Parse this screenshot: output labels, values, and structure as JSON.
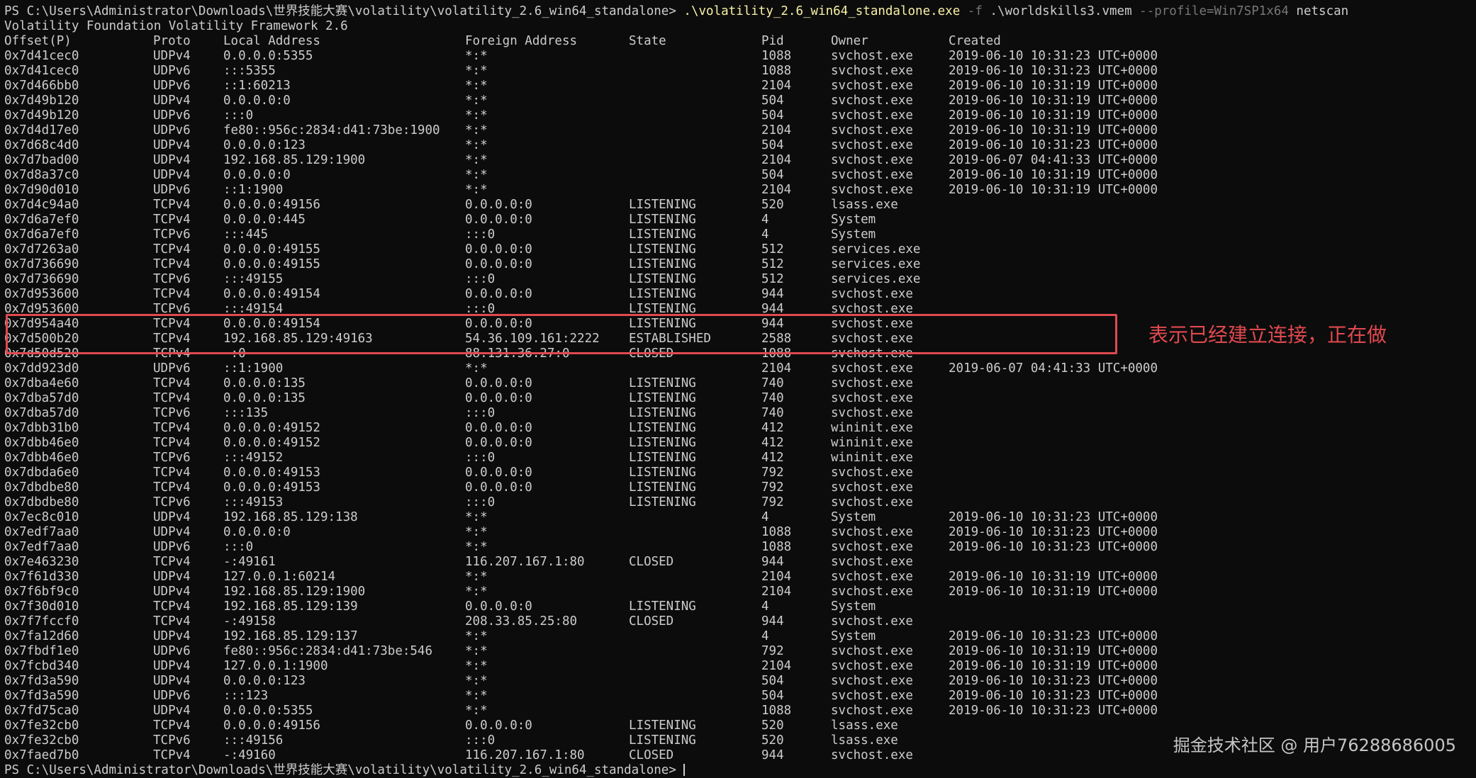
{
  "terminal": {
    "command_line": {
      "prompt": "PS C:\\Users\\Administrator\\Downloads\\世界技能大赛\\volatility\\volatility_2.6_win64_standalone> ",
      "executable": ".\\volatility_2.6_win64_standalone.exe",
      "flag_f": "-f",
      "file_arg": ".\\worldskills3.vmem",
      "flag_profile": "--profile=Win7SP1x64",
      "plugin": "netscan"
    },
    "banner": "Volatility Foundation Volatility Framework 2.6",
    "headers": {
      "offset": "Offset(P)",
      "proto": "Proto",
      "local": "Local Address",
      "foreign": "Foreign Address",
      "state": "State",
      "pid": "Pid",
      "owner": "Owner",
      "created": "Created"
    },
    "rows": [
      {
        "offset": "0x7d41cec0",
        "proto": "UDPv4",
        "local": "0.0.0.0:5355",
        "foreign": "*:*",
        "state": "",
        "pid": "1088",
        "owner": "svchost.exe",
        "created": "2019-06-10 10:31:23 UTC+0000"
      },
      {
        "offset": "0x7d41cec0",
        "proto": "UDPv6",
        "local": ":::5355",
        "foreign": "*:*",
        "state": "",
        "pid": "1088",
        "owner": "svchost.exe",
        "created": "2019-06-10 10:31:23 UTC+0000"
      },
      {
        "offset": "0x7d466bb0",
        "proto": "UDPv6",
        "local": "::1:60213",
        "foreign": "*:*",
        "state": "",
        "pid": "2104",
        "owner": "svchost.exe",
        "created": "2019-06-10 10:31:19 UTC+0000"
      },
      {
        "offset": "0x7d49b120",
        "proto": "UDPv4",
        "local": "0.0.0.0:0",
        "foreign": "*:*",
        "state": "",
        "pid": "504",
        "owner": "svchost.exe",
        "created": "2019-06-10 10:31:19 UTC+0000"
      },
      {
        "offset": "0x7d49b120",
        "proto": "UDPv6",
        "local": ":::0",
        "foreign": "*:*",
        "state": "",
        "pid": "504",
        "owner": "svchost.exe",
        "created": "2019-06-10 10:31:19 UTC+0000"
      },
      {
        "offset": "0x7d4d17e0",
        "proto": "UDPv6",
        "local": "fe80::956c:2834:d41:73be:1900",
        "foreign": "*:*",
        "state": "",
        "pid": "2104",
        "owner": "svchost.exe",
        "created": "2019-06-10 10:31:19 UTC+0000"
      },
      {
        "offset": "0x7d68c4d0",
        "proto": "UDPv4",
        "local": "0.0.0.0:123",
        "foreign": "*:*",
        "state": "",
        "pid": "504",
        "owner": "svchost.exe",
        "created": "2019-06-10 10:31:23 UTC+0000"
      },
      {
        "offset": "0x7d7bad00",
        "proto": "UDPv4",
        "local": "192.168.85.129:1900",
        "foreign": "*:*",
        "state": "",
        "pid": "2104",
        "owner": "svchost.exe",
        "created": "2019-06-07 04:41:33 UTC+0000"
      },
      {
        "offset": "0x7d8a37c0",
        "proto": "UDPv4",
        "local": "0.0.0.0:0",
        "foreign": "*:*",
        "state": "",
        "pid": "504",
        "owner": "svchost.exe",
        "created": "2019-06-10 10:31:19 UTC+0000"
      },
      {
        "offset": "0x7d90d010",
        "proto": "UDPv6",
        "local": "::1:1900",
        "foreign": "*:*",
        "state": "",
        "pid": "2104",
        "owner": "svchost.exe",
        "created": "2019-06-10 10:31:19 UTC+0000"
      },
      {
        "offset": "0x7d4c94a0",
        "proto": "TCPv4",
        "local": "0.0.0.0:49156",
        "foreign": "0.0.0.0:0",
        "state": "LISTENING",
        "pid": "520",
        "owner": "lsass.exe",
        "created": ""
      },
      {
        "offset": "0x7d6a7ef0",
        "proto": "TCPv4",
        "local": "0.0.0.0:445",
        "foreign": "0.0.0.0:0",
        "state": "LISTENING",
        "pid": "4",
        "owner": "System",
        "created": ""
      },
      {
        "offset": "0x7d6a7ef0",
        "proto": "TCPv6",
        "local": ":::445",
        "foreign": ":::0",
        "state": "LISTENING",
        "pid": "4",
        "owner": "System",
        "created": ""
      },
      {
        "offset": "0x7d7263a0",
        "proto": "TCPv4",
        "local": "0.0.0.0:49155",
        "foreign": "0.0.0.0:0",
        "state": "LISTENING",
        "pid": "512",
        "owner": "services.exe",
        "created": ""
      },
      {
        "offset": "0x7d736690",
        "proto": "TCPv4",
        "local": "0.0.0.0:49155",
        "foreign": "0.0.0.0:0",
        "state": "LISTENING",
        "pid": "512",
        "owner": "services.exe",
        "created": ""
      },
      {
        "offset": "0x7d736690",
        "proto": "TCPv6",
        "local": ":::49155",
        "foreign": ":::0",
        "state": "LISTENING",
        "pid": "512",
        "owner": "services.exe",
        "created": ""
      },
      {
        "offset": "0x7d953600",
        "proto": "TCPv4",
        "local": "0.0.0.0:49154",
        "foreign": "0.0.0.0:0",
        "state": "LISTENING",
        "pid": "944",
        "owner": "svchost.exe",
        "created": ""
      },
      {
        "offset": "0x7d953600",
        "proto": "TCPv6",
        "local": ":::49154",
        "foreign": ":::0",
        "state": "LISTENING",
        "pid": "944",
        "owner": "svchost.exe",
        "created": ""
      },
      {
        "offset": "0x7d954a40",
        "proto": "TCPv4",
        "local": "0.0.0.0:49154",
        "foreign": "0.0.0.0:0",
        "state": "LISTENING",
        "pid": "944",
        "owner": "svchost.exe",
        "created": ""
      },
      {
        "offset": "0x7d500b20",
        "proto": "TCPv4",
        "local": "192.168.85.129:49163",
        "foreign": "54.36.109.161:2222",
        "state": "ESTABLISHED",
        "pid": "2588",
        "owner": "svchost.exe",
        "created": ""
      },
      {
        "offset": "0x7d50d520",
        "proto": "TCPv4",
        "local": "-:0",
        "foreign": "88.131.36.27:0",
        "state": "CLOSED",
        "pid": "1088",
        "owner": "svchost.exe",
        "created": ""
      },
      {
        "offset": "0x7dd923d0",
        "proto": "UDPv6",
        "local": "::1:1900",
        "foreign": "*:*",
        "state": "",
        "pid": "2104",
        "owner": "svchost.exe",
        "created": "2019-06-07 04:41:33 UTC+0000"
      },
      {
        "offset": "0x7dba4e60",
        "proto": "TCPv4",
        "local": "0.0.0.0:135",
        "foreign": "0.0.0.0:0",
        "state": "LISTENING",
        "pid": "740",
        "owner": "svchost.exe",
        "created": ""
      },
      {
        "offset": "0x7dba57d0",
        "proto": "TCPv4",
        "local": "0.0.0.0:135",
        "foreign": "0.0.0.0:0",
        "state": "LISTENING",
        "pid": "740",
        "owner": "svchost.exe",
        "created": ""
      },
      {
        "offset": "0x7dba57d0",
        "proto": "TCPv6",
        "local": ":::135",
        "foreign": ":::0",
        "state": "LISTENING",
        "pid": "740",
        "owner": "svchost.exe",
        "created": ""
      },
      {
        "offset": "0x7dbb31b0",
        "proto": "TCPv4",
        "local": "0.0.0.0:49152",
        "foreign": "0.0.0.0:0",
        "state": "LISTENING",
        "pid": "412",
        "owner": "wininit.exe",
        "created": ""
      },
      {
        "offset": "0x7dbb46e0",
        "proto": "TCPv4",
        "local": "0.0.0.0:49152",
        "foreign": "0.0.0.0:0",
        "state": "LISTENING",
        "pid": "412",
        "owner": "wininit.exe",
        "created": ""
      },
      {
        "offset": "0x7dbb46e0",
        "proto": "TCPv6",
        "local": ":::49152",
        "foreign": ":::0",
        "state": "LISTENING",
        "pid": "412",
        "owner": "wininit.exe",
        "created": ""
      },
      {
        "offset": "0x7dbda6e0",
        "proto": "TCPv4",
        "local": "0.0.0.0:49153",
        "foreign": "0.0.0.0:0",
        "state": "LISTENING",
        "pid": "792",
        "owner": "svchost.exe",
        "created": ""
      },
      {
        "offset": "0x7dbdbe80",
        "proto": "TCPv4",
        "local": "0.0.0.0:49153",
        "foreign": "0.0.0.0:0",
        "state": "LISTENING",
        "pid": "792",
        "owner": "svchost.exe",
        "created": ""
      },
      {
        "offset": "0x7dbdbe80",
        "proto": "TCPv6",
        "local": ":::49153",
        "foreign": ":::0",
        "state": "LISTENING",
        "pid": "792",
        "owner": "svchost.exe",
        "created": ""
      },
      {
        "offset": "0x7ec8c010",
        "proto": "UDPv4",
        "local": "192.168.85.129:138",
        "foreign": "*:*",
        "state": "",
        "pid": "4",
        "owner": "System",
        "created": "2019-06-10 10:31:23 UTC+0000"
      },
      {
        "offset": "0x7edf7aa0",
        "proto": "UDPv4",
        "local": "0.0.0.0:0",
        "foreign": "*:*",
        "state": "",
        "pid": "1088",
        "owner": "svchost.exe",
        "created": "2019-06-10 10:31:23 UTC+0000"
      },
      {
        "offset": "0x7edf7aa0",
        "proto": "UDPv6",
        "local": ":::0",
        "foreign": "*:*",
        "state": "",
        "pid": "1088",
        "owner": "svchost.exe",
        "created": "2019-06-10 10:31:23 UTC+0000"
      },
      {
        "offset": "0x7e463230",
        "proto": "TCPv4",
        "local": "-:49161",
        "foreign": "116.207.167.1:80",
        "state": "CLOSED",
        "pid": "944",
        "owner": "svchost.exe",
        "created": ""
      },
      {
        "offset": "0x7f61d330",
        "proto": "UDPv4",
        "local": "127.0.0.1:60214",
        "foreign": "*:*",
        "state": "",
        "pid": "2104",
        "owner": "svchost.exe",
        "created": "2019-06-10 10:31:19 UTC+0000"
      },
      {
        "offset": "0x7f6bf9c0",
        "proto": "UDPv4",
        "local": "192.168.85.129:1900",
        "foreign": "*:*",
        "state": "",
        "pid": "2104",
        "owner": "svchost.exe",
        "created": "2019-06-10 10:31:19 UTC+0000"
      },
      {
        "offset": "0x7f30d010",
        "proto": "TCPv4",
        "local": "192.168.85.129:139",
        "foreign": "0.0.0.0:0",
        "state": "LISTENING",
        "pid": "4",
        "owner": "System",
        "created": ""
      },
      {
        "offset": "0x7f7fccf0",
        "proto": "TCPv4",
        "local": "-:49158",
        "foreign": "208.33.85.25:80",
        "state": "CLOSED",
        "pid": "944",
        "owner": "svchost.exe",
        "created": ""
      },
      {
        "offset": "0x7fa12d60",
        "proto": "UDPv4",
        "local": "192.168.85.129:137",
        "foreign": "*:*",
        "state": "",
        "pid": "4",
        "owner": "System",
        "created": "2019-06-10 10:31:23 UTC+0000"
      },
      {
        "offset": "0x7fbdf1e0",
        "proto": "UDPv6",
        "local": "fe80::956c:2834:d41:73be:546",
        "foreign": "*:*",
        "state": "",
        "pid": "792",
        "owner": "svchost.exe",
        "created": "2019-06-10 10:31:19 UTC+0000"
      },
      {
        "offset": "0x7fcbd340",
        "proto": "UDPv4",
        "local": "127.0.0.1:1900",
        "foreign": "*:*",
        "state": "",
        "pid": "2104",
        "owner": "svchost.exe",
        "created": "2019-06-10 10:31:19 UTC+0000"
      },
      {
        "offset": "0x7fd3a590",
        "proto": "UDPv4",
        "local": "0.0.0.0:123",
        "foreign": "*:*",
        "state": "",
        "pid": "504",
        "owner": "svchost.exe",
        "created": "2019-06-10 10:31:23 UTC+0000"
      },
      {
        "offset": "0x7fd3a590",
        "proto": "UDPv6",
        "local": ":::123",
        "foreign": "*:*",
        "state": "",
        "pid": "504",
        "owner": "svchost.exe",
        "created": "2019-06-10 10:31:23 UTC+0000"
      },
      {
        "offset": "0x7fd75ca0",
        "proto": "UDPv4",
        "local": "0.0.0.0:5355",
        "foreign": "*:*",
        "state": "",
        "pid": "1088",
        "owner": "svchost.exe",
        "created": "2019-06-10 10:31:23 UTC+0000"
      },
      {
        "offset": "0x7fe32cb0",
        "proto": "TCPv4",
        "local": "0.0.0.0:49156",
        "foreign": "0.0.0.0:0",
        "state": "LISTENING",
        "pid": "520",
        "owner": "lsass.exe",
        "created": ""
      },
      {
        "offset": "0x7fe32cb0",
        "proto": "TCPv6",
        "local": ":::49156",
        "foreign": ":::0",
        "state": "LISTENING",
        "pid": "520",
        "owner": "lsass.exe",
        "created": ""
      },
      {
        "offset": "0x7faed7b0",
        "proto": "TCPv4",
        "local": "-:49160",
        "foreign": "116.207.167.1:80",
        "state": "CLOSED",
        "pid": "944",
        "owner": "svchost.exe",
        "created": ""
      }
    ],
    "final_prompt": "PS C:\\Users\\Administrator\\Downloads\\世界技能大赛\\volatility\\volatility_2.6_win64_standalone> "
  },
  "annotation": {
    "text": "表示已经建立连接，正在做",
    "color": "#e0494f"
  },
  "watermark": {
    "text": "掘金技术社区 @ 用户76288686005"
  },
  "colors": {
    "background": "#0c0c0c",
    "text": "#cccccc",
    "command": "#f9f1a5",
    "flag": "#767676",
    "highlight": "#e0494f"
  }
}
